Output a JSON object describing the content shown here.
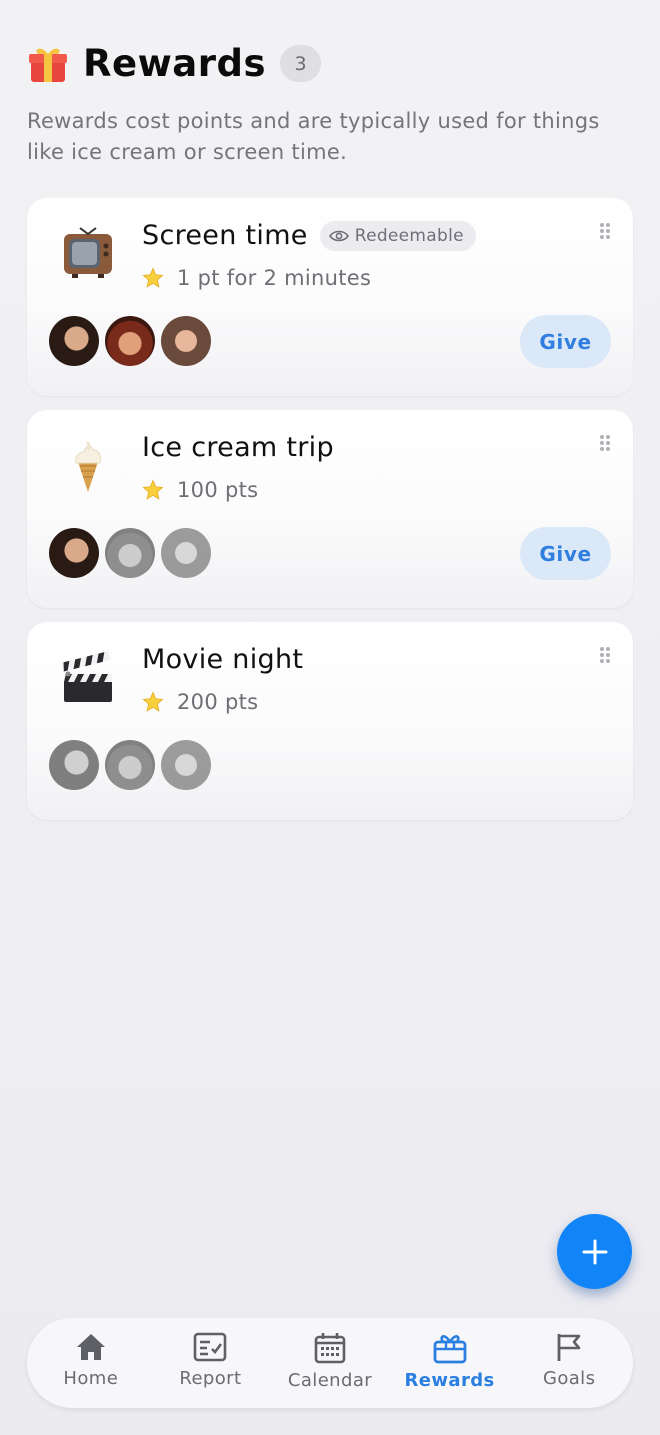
{
  "header": {
    "title": "Rewards",
    "count": "3",
    "icon": "gift-icon",
    "subtitle": "Rewards cost points and are typically used for things like ice cream or screen time."
  },
  "rewards": [
    {
      "title": "Screen time",
      "icon": "television-icon",
      "badge": "Redeemable",
      "points": "1 pt for 2 minutes",
      "give_label": "Give",
      "avatars_active": [
        true,
        true,
        true
      ]
    },
    {
      "title": "Ice cream trip",
      "icon": "ice-cream-icon",
      "points": "100 pts",
      "give_label": "Give",
      "avatars_active": [
        true,
        false,
        false
      ]
    },
    {
      "title": "Movie night",
      "icon": "clapper-board-icon",
      "points": "200 pts",
      "avatars_active": [
        false,
        false,
        false
      ]
    }
  ],
  "fab": {
    "icon": "plus-icon"
  },
  "tabs": [
    {
      "label": "Home",
      "icon": "home-icon",
      "active": false
    },
    {
      "label": "Report",
      "icon": "report-icon",
      "active": false
    },
    {
      "label": "Calendar",
      "icon": "calendar-icon",
      "active": false
    },
    {
      "label": "Rewards",
      "icon": "rewards-icon",
      "active": true
    },
    {
      "label": "Goals",
      "icon": "flag-icon",
      "active": false
    }
  ],
  "colors": {
    "accent": "#1184f7",
    "active_tab": "#2a7fe0",
    "give_bg": "#dbe8f8"
  }
}
